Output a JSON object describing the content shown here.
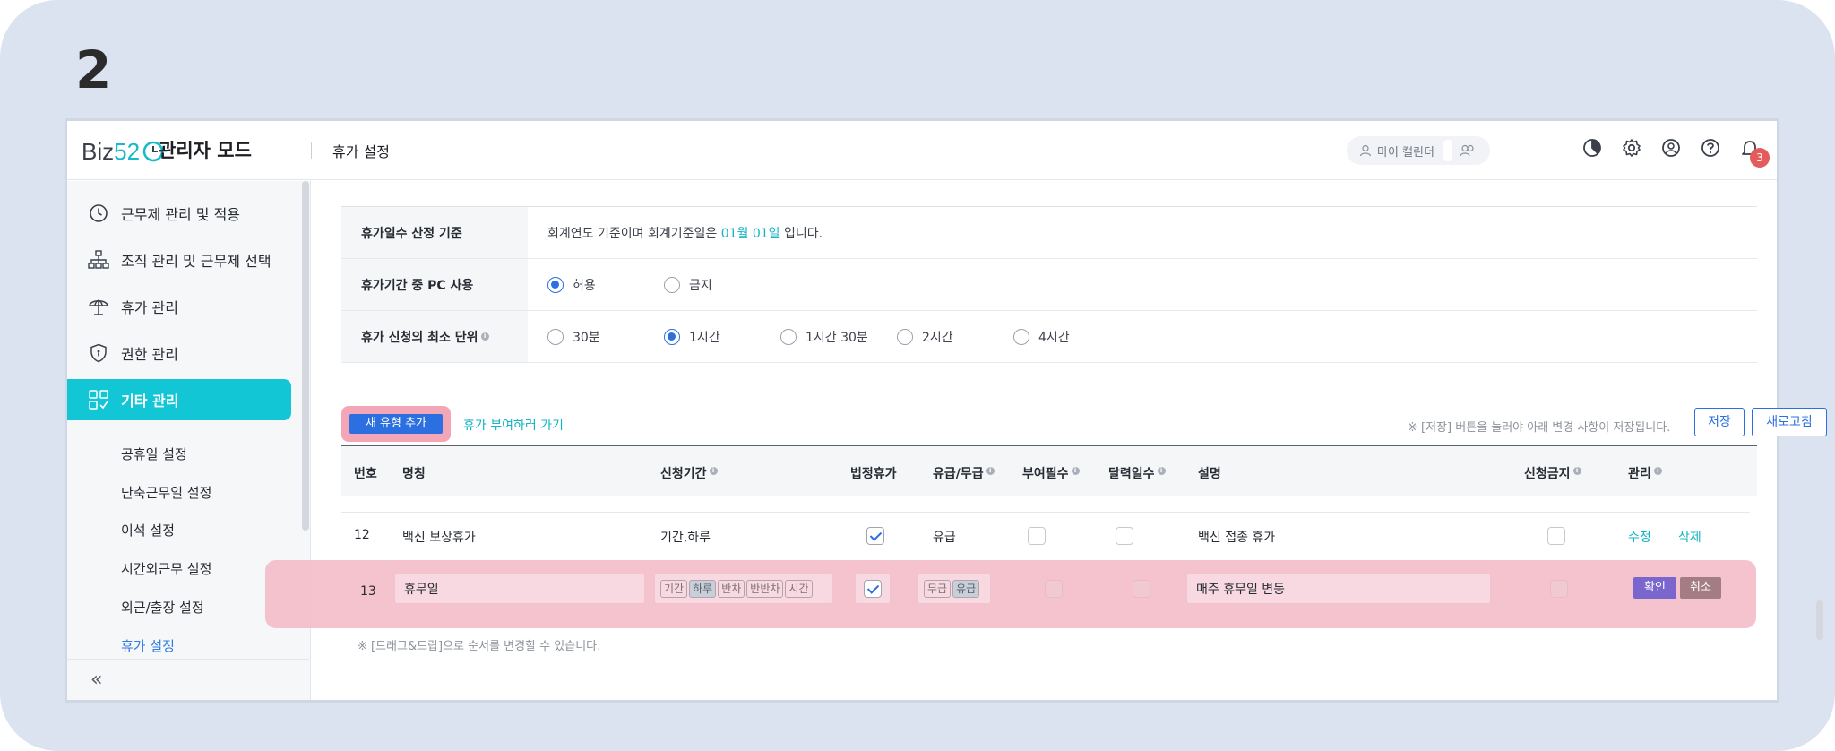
{
  "step_number": "2",
  "header": {
    "logo_text": "Biz",
    "logo_num": "52",
    "mode_title": "관리자 모드",
    "page_title": "휴가 설정",
    "my_calendar": "마이 캘린더",
    "notification_count": "3"
  },
  "sidebar": {
    "items": [
      {
        "label": "근무제 관리 및 적용",
        "icon": "clock-icon"
      },
      {
        "label": "조직 관리 및 근무제 선택",
        "icon": "org-chart-icon"
      },
      {
        "label": "휴가 관리",
        "icon": "umbrella-icon"
      },
      {
        "label": "권한 관리",
        "icon": "shield-icon"
      },
      {
        "label": "기타 관리",
        "icon": "grid-icon"
      }
    ],
    "sub_items": [
      "공휴일 설정",
      "단축근무일 설정",
      "이석 설정",
      "시간외근무 설정",
      "외근/출장 설정",
      "휴가 설정"
    ],
    "collapse_label": "«"
  },
  "settings": {
    "row1": {
      "label": "휴가일수 산정 기준",
      "text_pre": "회계연도 기준이며 회계기준일은",
      "date": "01월 01일",
      "text_post": "입니다."
    },
    "row2": {
      "label": "휴가기간 중 PC 사용",
      "options": [
        "허용",
        "금지"
      ],
      "selected": "허용"
    },
    "row3": {
      "label": "휴가 신청의 최소 단위",
      "options": [
        "30분",
        "1시간",
        "1시간 30분",
        "2시간",
        "4시간"
      ],
      "selected": "1시간"
    }
  },
  "toolbar": {
    "new_type": "새 유형 추가",
    "goto_grant": "휴가 부여하러 가기",
    "save_note": "※ [저장] 버튼을 눌러야 아래 변경 사항이 저장됩니다.",
    "save": "저장",
    "refresh": "새로고침"
  },
  "table": {
    "headers": [
      "번호",
      "명칭",
      "신청기간",
      "법정휴가",
      "유급/무급",
      "부여필수",
      "달력일수",
      "설명",
      "신청금지",
      "관리"
    ],
    "row12": {
      "no": "12",
      "name": "백신 보상휴가",
      "period": "기간,하루",
      "paid": "유급",
      "desc": "백신 접종 휴가",
      "edit": "수정",
      "delete": "삭제"
    },
    "row13": {
      "no": "13",
      "name": "휴무일",
      "period_chips": [
        "기간",
        "하루",
        "반차",
        "반반차",
        "시간"
      ],
      "paid_chips": [
        "무급",
        "유급"
      ],
      "desc": "매주 휴무일 변동",
      "confirm": "확인",
      "cancel": "취소"
    },
    "drag_note": "※ [드래그&드랍]으로 순서를 변경할 수 있습니다."
  },
  "colors": {
    "accent": "#13c6d6",
    "primary": "#2c6fe0",
    "highlight": "#f3b8c6"
  }
}
